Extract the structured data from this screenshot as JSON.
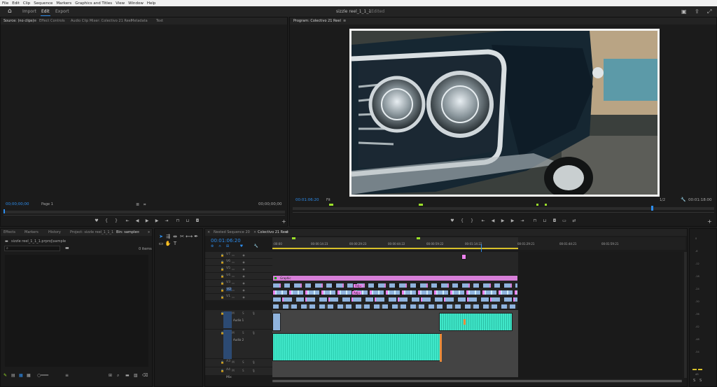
{
  "menu": [
    "File",
    "Edit",
    "Clip",
    "Sequence",
    "Markers",
    "Graphics and Titles",
    "View",
    "Window",
    "Help"
  ],
  "workspace": {
    "tabs": [
      "Import",
      "Edit",
      "Export"
    ],
    "active": "Edit",
    "title": "sizzle reel_1_1_1",
    "edited": "- Edited"
  },
  "source_panel": {
    "tabs": [
      "Source: (no clips)",
      "Effect Controls",
      "Audio Clip Mixer: Colectivo 21 Reel",
      "Metadata",
      "Text"
    ],
    "timecode_in": "00;00;00;00",
    "page": "Page 1",
    "timecode_out": "00;00;00;00"
  },
  "program_panel": {
    "title": "Program: Colectivo 21 Reel",
    "timecode": "00:01:06:20",
    "fit": "Fit",
    "resolution": "1/2",
    "duration": "00:01:18:00"
  },
  "project_panel": {
    "tabs": [
      "Effects",
      "Markers",
      "History",
      "Project: sizzle reel_1_1_1",
      "Bin: sample"
    ],
    "path": "sizzle reel_1_1_1.prproj\\sample",
    "items": "0 items"
  },
  "timeline": {
    "tabs": [
      "Nested Sequence 20",
      "Colectivo 21 Reel"
    ],
    "timecode": "00:01:06:20",
    "ruler": [
      ":00:00",
      "00:00:14:23",
      "00:00:29:23",
      "00:00:44:22",
      "00:00:59:22",
      "00:01:14:22",
      "00:01:29:21",
      "00:01:44:21",
      "00:01:59:21"
    ],
    "video_tracks": [
      "V7",
      "V6",
      "V5",
      "V4",
      "V3",
      "V2",
      "V1"
    ],
    "audio_tracks": [
      {
        "id": "A1",
        "name": "Audio 1"
      },
      {
        "id": "A2",
        "name": "Audio 2"
      },
      {
        "id": "A3",
        "name": ""
      },
      {
        "id": "A4",
        "name": ""
      }
    ],
    "mix": "Mix",
    "graphic_clip": "Graphic",
    "adju": "Adju"
  },
  "meters": [
    "0",
    "-6",
    "-12",
    "-18",
    "-24",
    "-30",
    "-36",
    "-42",
    "-48",
    "-54",
    "dB"
  ],
  "colors": {
    "accent": "#2d8ceb",
    "audio": "#3fe6c8",
    "video": "#8fb3dd",
    "graphic": "#d77fd8",
    "pink": "#ee82ee"
  }
}
